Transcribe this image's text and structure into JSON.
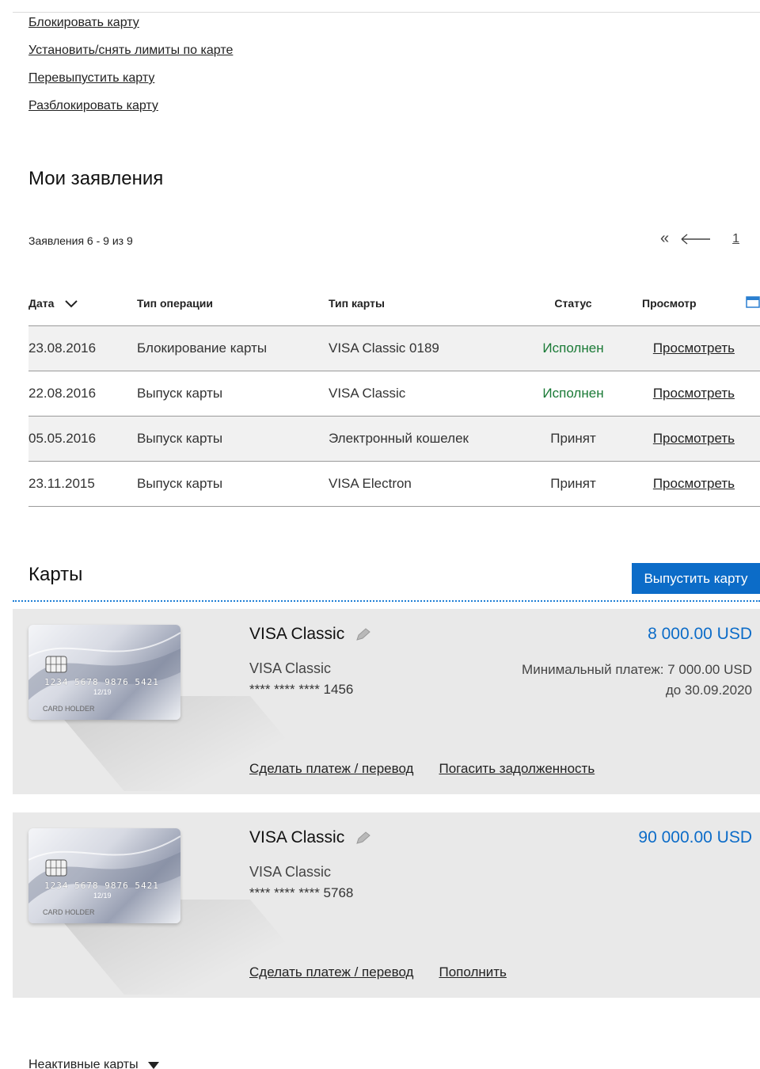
{
  "quick_links": [
    "Блокировать карту",
    "Установить/снять лимиты по карте",
    "Перевыпустить карту",
    "Разблокировать карту"
  ],
  "applications": {
    "title": "Мои заявления",
    "count_text": "Заявления 6 - 9 из 9",
    "pager": {
      "first": "«",
      "page": "1"
    },
    "columns": {
      "date": "Дата",
      "operation": "Тип операции",
      "card_type": "Тип карты",
      "status": "Статус",
      "view": "Просмотр"
    },
    "rows": [
      {
        "date": "23.08.2016",
        "operation": "Блокирование карты",
        "card_type": "VISA Classic 0189",
        "status": "Исполнен",
        "view": "Просмотреть"
      },
      {
        "date": "22.08.2016",
        "operation": "Выпуск карты",
        "card_type": "VISA Classic",
        "status": "Исполнен",
        "view": "Просмотреть"
      },
      {
        "date": "05.05.2016",
        "operation": "Выпуск карты",
        "card_type": "Электронный кошелек",
        "status": "Принят",
        "view": "Просмотреть"
      },
      {
        "date": "23.11.2015",
        "operation": "Выпуск карты",
        "card_type": "VISA Electron",
        "status": "Принят",
        "view": "Просмотреть"
      }
    ]
  },
  "cards": {
    "title": "Карты",
    "issue_button": "Выпустить карту",
    "items": [
      {
        "name": "VISA Classic",
        "type": "VISA Classic",
        "mask": "**** **** **** 1456",
        "balance": "8 000.00 USD",
        "min_payment": "Минимальный платеж: 7 000.00 USD",
        "due": "до 30.09.2020",
        "actions": [
          "Сделать платеж / перевод",
          "Погасить задолженность"
        ],
        "image": {
          "number": "1234 5678 9876 5421",
          "holder": "CARD HOLDER",
          "exp": "12/19"
        }
      },
      {
        "name": "VISA Classic",
        "type": "VISA Classic",
        "mask": "**** **** **** 5768",
        "balance": "90 000.00 USD",
        "actions": [
          "Сделать платеж / перевод",
          "Пополнить"
        ],
        "image": {
          "number": "1234 5678 9876 5421",
          "holder": "CARD HOLDER",
          "exp": "12/19"
        }
      }
    ],
    "inactive_label": "Неактивные карты"
  },
  "colors": {
    "accent": "#0c6cc8",
    "status_done": "#1a7a36",
    "panel": "#e9e9e9"
  }
}
